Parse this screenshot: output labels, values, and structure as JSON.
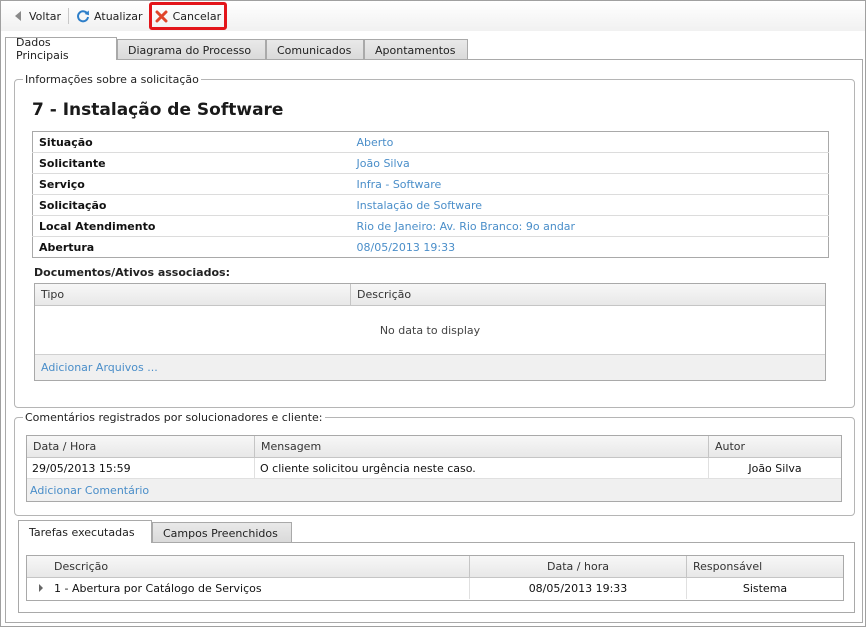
{
  "toolbar": {
    "back_label": "Voltar",
    "refresh_label": "Atualizar",
    "cancel_label": "Cancelar"
  },
  "main_tabs": [
    {
      "label": "Dados Principais",
      "active": true
    },
    {
      "label": "Diagrama do Processo",
      "active": false
    },
    {
      "label": "Comunicados",
      "active": false
    },
    {
      "label": "Apontamentos",
      "active": false
    }
  ],
  "info": {
    "legend": "Informações sobre a solicitação",
    "title": "7 - Instalação de Software",
    "properties": [
      {
        "key": "Situação",
        "value": "Aberto"
      },
      {
        "key": "Solicitante",
        "value": "João Silva"
      },
      {
        "key": "Serviço",
        "value": "Infra - Software"
      },
      {
        "key": "Solicitação",
        "value": "Instalação de Software"
      },
      {
        "key": "Local Atendimento",
        "value": "Rio de Janeiro: Av. Rio Branco: 9o andar"
      },
      {
        "key": "Abertura",
        "value": "08/05/2013 19:33"
      }
    ],
    "documents_label": "Documentos/Ativos associados:",
    "documents_columns": [
      "Tipo",
      "Descrição"
    ],
    "documents_empty": "No data to display",
    "add_files_label": "Adicionar Arquivos ..."
  },
  "comments": {
    "legend": "Comentários registrados por solucionadores e cliente:",
    "columns": [
      "Data / Hora",
      "Mensagem",
      "Autor"
    ],
    "rows": [
      {
        "datetime": "29/05/2013 15:59",
        "message": "O cliente solicitou urgência neste caso.",
        "author": "João Silva"
      }
    ],
    "add_label": "Adicionar Comentário"
  },
  "bottom_tabs": [
    {
      "label": "Tarefas executadas",
      "active": true
    },
    {
      "label": "Campos Preenchidos",
      "active": false
    }
  ],
  "tasks": {
    "columns": [
      "Descrição",
      "Data / hora",
      "Responsável"
    ],
    "rows": [
      {
        "description": "1 - Abertura por Catálogo de Serviços",
        "datetime": "08/05/2013 19:33",
        "responsible": "Sistema"
      }
    ]
  },
  "colors": {
    "link": "#4a8ec9",
    "cancel_highlight": "#e3151a"
  }
}
